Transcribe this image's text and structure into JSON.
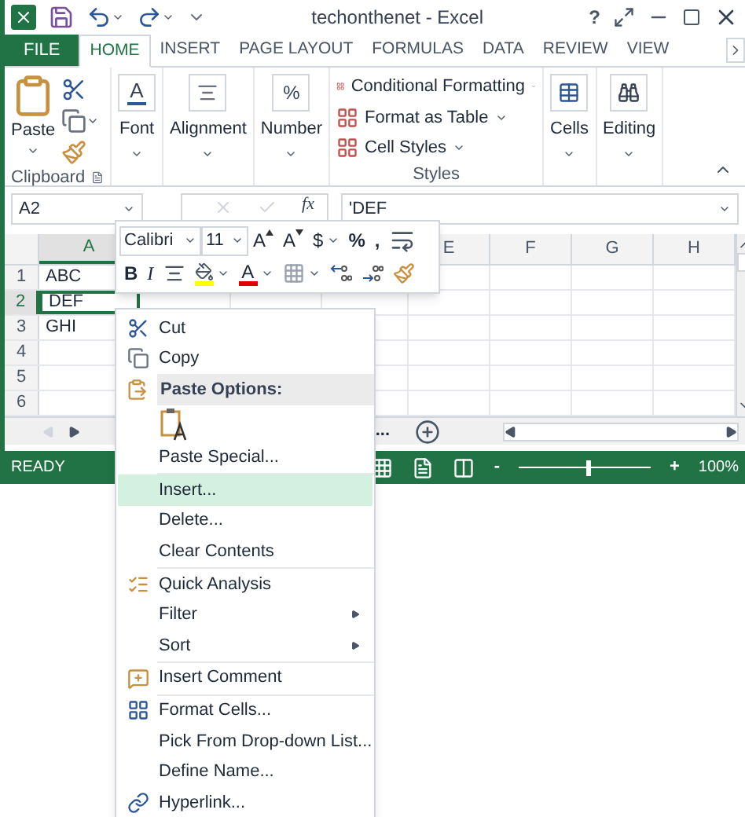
{
  "title_bar": {
    "title": "techonthenet - Excel",
    "help": "?"
  },
  "tabs": [
    {
      "label": "FILE",
      "kind": "file",
      "selected": false
    },
    {
      "label": "HOME",
      "kind": "tab",
      "selected": true
    },
    {
      "label": "INSERT",
      "kind": "tab",
      "selected": false
    },
    {
      "label": "PAGE LAYOUT",
      "kind": "tab",
      "selected": false
    },
    {
      "label": "FORMULAS",
      "kind": "tab",
      "selected": false
    },
    {
      "label": "DATA",
      "kind": "tab",
      "selected": false
    },
    {
      "label": "REVIEW",
      "kind": "tab",
      "selected": false
    },
    {
      "label": "VIEW",
      "kind": "tab",
      "selected": false
    }
  ],
  "clipboard": {
    "paste": "Paste",
    "label": "Clipboard"
  },
  "big_buttons": [
    {
      "label": "Font",
      "kind": "font",
      "glyph": "A"
    },
    {
      "label": "Alignment",
      "kind": "alignment"
    },
    {
      "label": "Number",
      "kind": "number",
      "glyph": "%"
    }
  ],
  "styles": {
    "items": [
      "Conditional Formatting",
      "Format as Table",
      "Cell Styles"
    ],
    "label": "Styles"
  },
  "tail_buttons": [
    {
      "label": "Cells",
      "kind": "cells"
    },
    {
      "label": "Editing",
      "kind": "editing"
    }
  ],
  "formula_bar": {
    "name_box": "A2",
    "function_label": "fx",
    "value": "'DEF"
  },
  "columns": [
    {
      "label": "A",
      "selected": true
    },
    {},
    {},
    {},
    {
      "label": "E",
      "selected": false
    },
    {
      "label": "F",
      "selected": false
    },
    {
      "label": "G",
      "selected": false
    },
    {
      "label": "H",
      "selected": false
    }
  ],
  "rows": [
    {
      "header": "1",
      "selected": false,
      "cells": [
        {
          "text": "ABC",
          "selected": false
        }
      ]
    },
    {
      "header": "2",
      "selected": true,
      "cells": [
        {
          "text": "DEF",
          "selected": true
        }
      ]
    },
    {
      "header": "3",
      "selected": false,
      "cells": [
        {
          "text": "GHI",
          "selected": false
        }
      ]
    },
    {
      "header": "4",
      "selected": false,
      "cells": []
    },
    {
      "header": "5",
      "selected": false,
      "cells": []
    },
    {
      "header": "6",
      "selected": false,
      "cells": []
    }
  ],
  "sheet_bar": {
    "more": "..."
  },
  "status_bar": {
    "status": "READY",
    "zoom_out": "-",
    "zoom_in": "+",
    "level": 0.52,
    "zoom": "100%"
  },
  "mini_toolbar": {
    "font": "Calibri",
    "size": "11",
    "row1": [
      {
        "kind": "grow",
        "text": "A"
      },
      {
        "kind": "shrink",
        "text": "A"
      },
      {
        "kind": "dropdown-text",
        "text": "$"
      },
      {
        "kind": "text",
        "text": "%"
      },
      {
        "kind": "text",
        "text": ","
      },
      {
        "kind": "wrap"
      }
    ],
    "row2": [
      {
        "kind": "bold",
        "text": "B"
      },
      {
        "kind": "italic",
        "text": "I"
      },
      {
        "kind": "align"
      },
      {
        "kind": "fill"
      },
      {
        "kind": "font-color",
        "text": "A"
      },
      {
        "kind": "borders"
      },
      {
        "kind": "increase-decimal"
      },
      {
        "kind": "decrease-decimal"
      },
      {
        "kind": "painter"
      }
    ]
  },
  "context_menu": [
    {
      "kind": "command",
      "label": "Cut",
      "highlighted": false,
      "submenu": false
    },
    {
      "kind": "command",
      "label": "Copy",
      "highlighted": false,
      "submenu": false
    },
    {
      "kind": "header",
      "label": "Paste Options:"
    },
    {
      "kind": "paste-option"
    },
    {
      "kind": "command",
      "label": "Paste Special...",
      "highlighted": false,
      "submenu": false
    },
    {
      "kind": "separator"
    },
    {
      "kind": "command",
      "label": "Insert...",
      "highlighted": true,
      "submenu": false
    },
    {
      "kind": "command",
      "label": "Delete...",
      "highlighted": false,
      "submenu": false
    },
    {
      "kind": "command",
      "label": "Clear Contents",
      "highlighted": false,
      "submenu": false
    },
    {
      "kind": "separator"
    },
    {
      "kind": "command",
      "label": "Quick Analysis",
      "highlighted": false,
      "submenu": false
    },
    {
      "kind": "command",
      "label": "Filter",
      "highlighted": false,
      "submenu": true
    },
    {
      "kind": "command",
      "label": "Sort",
      "highlighted": false,
      "submenu": true
    },
    {
      "kind": "separator"
    },
    {
      "kind": "command",
      "label": "Insert Comment",
      "highlighted": false,
      "submenu": false
    },
    {
      "kind": "separator"
    },
    {
      "kind": "command",
      "label": "Format Cells...",
      "highlighted": false,
      "submenu": false
    },
    {
      "kind": "command",
      "label": "Pick From Drop-down List...",
      "highlighted": false,
      "submenu": false
    },
    {
      "kind": "command",
      "label": "Define Name...",
      "highlighted": false,
      "submenu": false
    },
    {
      "kind": "command",
      "label": "Hyperlink...",
      "highlighted": false,
      "submenu": false
    }
  ]
}
